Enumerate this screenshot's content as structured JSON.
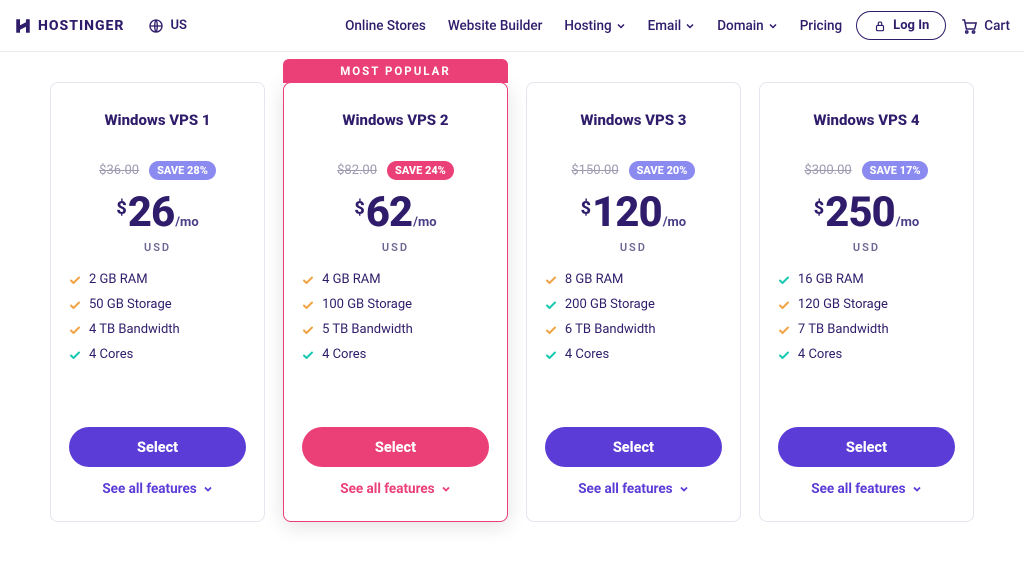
{
  "header": {
    "brand": "HOSTINGER",
    "region": "US",
    "nav": {
      "online_stores": "Online Stores",
      "website_builder": "Website Builder",
      "hosting": "Hosting",
      "email": "Email",
      "domain": "Domain",
      "pricing": "Pricing"
    },
    "login": "Log In",
    "cart": "Cart"
  },
  "ribbon": "MOST POPULAR",
  "labels": {
    "currency_symbol": "$",
    "per_month": "/mo",
    "currency": "USD",
    "select": "Select",
    "see_all": "See all features"
  },
  "plans": [
    {
      "name": "Windows VPS 1",
      "old_price": "$36.00",
      "save": "SAVE 28%",
      "price": "26",
      "features": [
        {
          "text": "2 GB RAM",
          "color": "orange"
        },
        {
          "text": "50 GB Storage",
          "color": "orange"
        },
        {
          "text": "4 TB Bandwidth",
          "color": "orange"
        },
        {
          "text": "4 Cores",
          "color": "teal"
        }
      ]
    },
    {
      "name": "Windows VPS 2",
      "old_price": "$82.00",
      "save": "SAVE 24%",
      "price": "62",
      "features": [
        {
          "text": "4 GB RAM",
          "color": "orange"
        },
        {
          "text": "100 GB Storage",
          "color": "orange"
        },
        {
          "text": "5 TB Bandwidth",
          "color": "orange"
        },
        {
          "text": "4 Cores",
          "color": "teal"
        }
      ]
    },
    {
      "name": "Windows VPS 3",
      "old_price": "$150.00",
      "save": "SAVE 20%",
      "price": "120",
      "features": [
        {
          "text": "8 GB RAM",
          "color": "orange"
        },
        {
          "text": "200 GB Storage",
          "color": "teal"
        },
        {
          "text": "6 TB Bandwidth",
          "color": "orange"
        },
        {
          "text": "4 Cores",
          "color": "teal"
        }
      ]
    },
    {
      "name": "Windows VPS 4",
      "old_price": "$300.00",
      "save": "SAVE 17%",
      "price": "250",
      "features": [
        {
          "text": "16 GB RAM",
          "color": "teal"
        },
        {
          "text": "120 GB Storage",
          "color": "orange"
        },
        {
          "text": "7 TB Bandwidth",
          "color": "orange"
        },
        {
          "text": "4 Cores",
          "color": "teal"
        }
      ]
    }
  ]
}
